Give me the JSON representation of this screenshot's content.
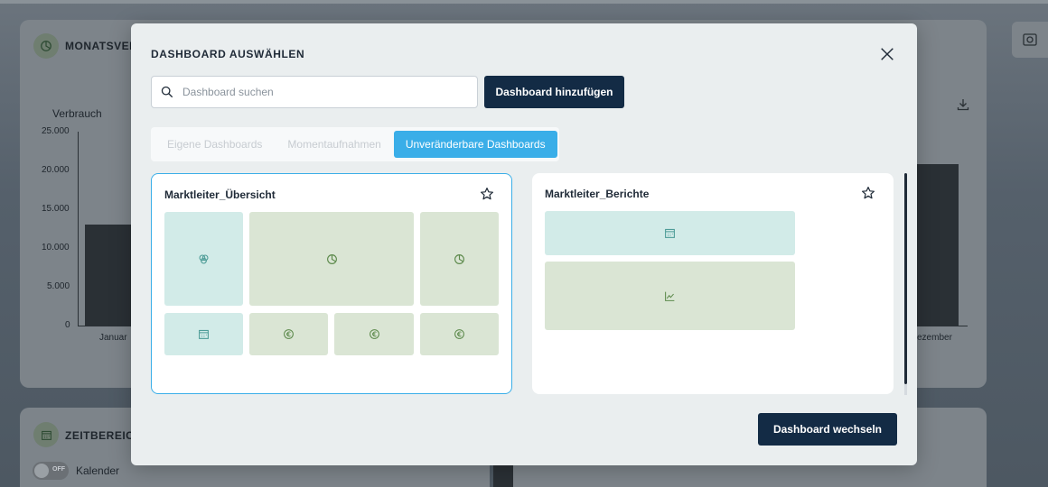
{
  "background": {
    "top_card_title": "MONATSVERE",
    "bottom_card_title": "ZEITBEREICH",
    "y_axis_label": "Verbrauch",
    "y_ticks": [
      "25.000",
      "20.000",
      "15.000",
      "10.000",
      "5.000",
      "0"
    ],
    "x_first_label": "Januar",
    "x_last_label": "ezember",
    "toggle_state": "OFF",
    "toggle_label": "Kalender"
  },
  "modal": {
    "title": "DASHBOARD AUSWÄHLEN",
    "search": {
      "placeholder": "Dashboard suchen",
      "value": ""
    },
    "add_button": "Dashboard hinzufügen",
    "tabs": [
      {
        "label": "Eigene Dashboards",
        "active": false
      },
      {
        "label": "Momentaufnahmen",
        "active": false
      },
      {
        "label": "Unveränderbare Dashboards",
        "active": true
      }
    ],
    "cards": [
      {
        "title": "Marktleiter_Übersicht",
        "selected": true
      },
      {
        "title": "Marktleiter_Berichte",
        "selected": false
      }
    ],
    "switch_button": "Dashboard wechseln"
  },
  "colors": {
    "primary": "#132b45",
    "accent": "#3aaee8",
    "tile_teal": "#d2ebe8",
    "tile_green": "#dae5d4",
    "icon_teal": "#4a9a95",
    "icon_green": "#5d8a4c"
  },
  "icons": [
    "close-icon",
    "search-icon",
    "star-icon",
    "calendar-icon",
    "pie-chart-icon",
    "venn-icon",
    "euro-icon",
    "line-chart-icon",
    "download-icon",
    "screenshot-icon"
  ]
}
